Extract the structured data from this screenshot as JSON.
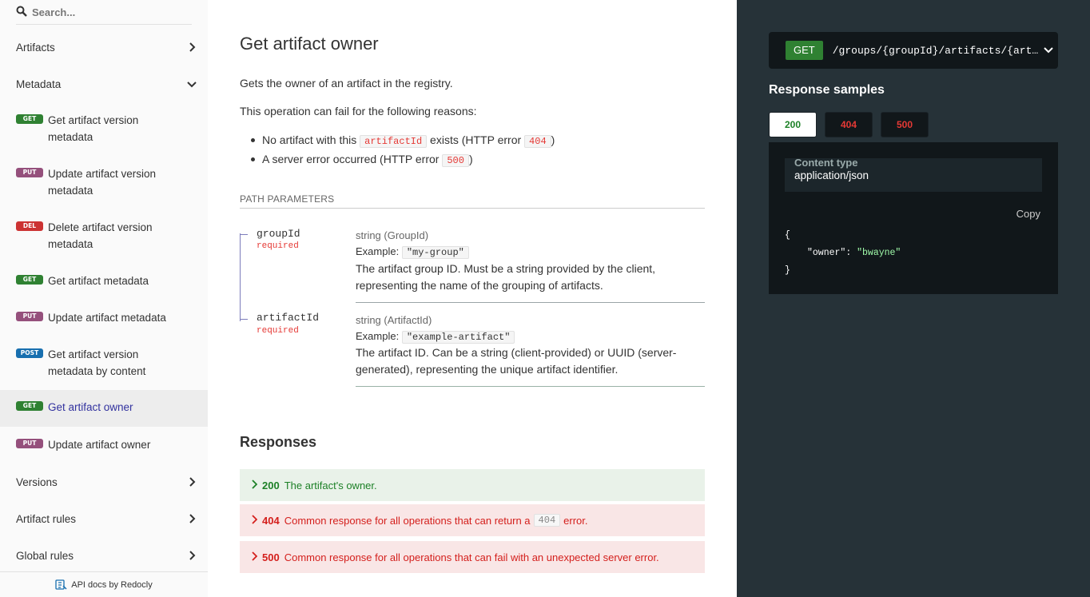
{
  "sidebar": {
    "search_placeholder": "Search...",
    "sections": [
      {
        "label": "Artifacts"
      },
      {
        "label": "Metadata"
      },
      {
        "label": "Versions"
      },
      {
        "label": "Artifact rules"
      },
      {
        "label": "Global rules"
      }
    ],
    "operations": [
      {
        "method": "GET",
        "label": "Get artifact version metadata"
      },
      {
        "method": "PUT",
        "label": "Update artifact version metadata"
      },
      {
        "method": "DEL",
        "label": "Delete artifact version metadata"
      },
      {
        "method": "GET",
        "label": "Get artifact metadata"
      },
      {
        "method": "PUT",
        "label": "Update artifact metadata"
      },
      {
        "method": "POST",
        "label": "Get artifact version metadata by content"
      },
      {
        "method": "GET",
        "label": "Get artifact owner"
      },
      {
        "method": "PUT",
        "label": "Update artifact owner"
      }
    ],
    "footer": "API docs by Redocly"
  },
  "main": {
    "title": "Get artifact owner",
    "description": "Gets the owner of an artifact in the registry.",
    "fail_intro": "This operation can fail for the following reasons:",
    "reasons": [
      {
        "before": "No artifact with this ",
        "code": "artifactId",
        "middle": " exists (HTTP error ",
        "code2": "404",
        "after": ")"
      },
      {
        "before": "A server error occurred (HTTP error ",
        "code": "500",
        "after": ")"
      }
    ],
    "path_params_header": "PATH PARAMETERS",
    "params": [
      {
        "name": "groupId",
        "required": "required",
        "type": "string (GroupId)",
        "example_label": "Example:",
        "example": "\"my-group\"",
        "description": "The artifact group ID. Must be a string provided by the client, representing the name of the grouping of artifacts."
      },
      {
        "name": "artifactId",
        "required": "required",
        "type": "string (ArtifactId)",
        "example_label": "Example:",
        "example": "\"example-artifact\"",
        "description": "The artifact ID. Can be a string (client-provided) or UUID (server-generated), representing the unique artifact identifier."
      }
    ],
    "responses_title": "Responses",
    "responses": [
      {
        "code": "200",
        "text": "The artifact's owner."
      },
      {
        "code": "404",
        "before": "Common response for all operations that can return a ",
        "inline": "404",
        "after": " error."
      },
      {
        "code": "500",
        "text": "Common response for all operations that can fail with an unexpected server error."
      }
    ]
  },
  "right": {
    "method": "GET",
    "path": "/groups/{groupId}/artifacts/{artifactId}/owner",
    "samples_title": "Response samples",
    "tabs": [
      "200",
      "404",
      "500"
    ],
    "content_type_label": "Content type",
    "content_type": "application/json",
    "copy_label": "Copy",
    "json_open": "{",
    "json_key": "\"owner\"",
    "json_sep": ": ",
    "json_value": "\"bwayne\"",
    "json_close": "}"
  },
  "colors": {
    "get": "#2f8132",
    "put": "#95507c",
    "del": "#cc3333",
    "post": "#186faf",
    "active_link": "#32329f",
    "error": "#e53935",
    "success": "#1d8127",
    "right_panel": "#263238"
  }
}
